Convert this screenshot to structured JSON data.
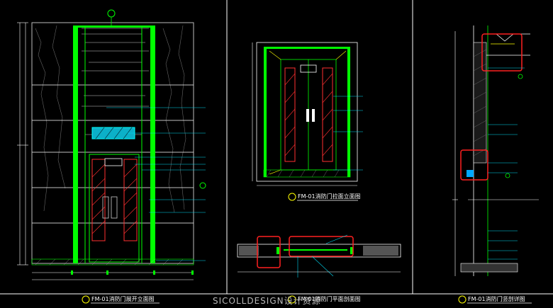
{
  "titles": {
    "left": "FM-01消防门展开立面图",
    "middle": "FM-01消防门拉面立面图",
    "bottom": "FM-01消防门平面剖面图",
    "right": "FM-01消防门竖剖详图"
  },
  "watermark": "SICOLLDESIGN设计资源",
  "colors": {
    "background": "#000000",
    "frame": "#ffffff",
    "door_frame": "#00ff00",
    "callout": "#00e5ff",
    "highlight": "#ff2020",
    "hatch": "#ff3030",
    "dimension": "#ffff00"
  }
}
